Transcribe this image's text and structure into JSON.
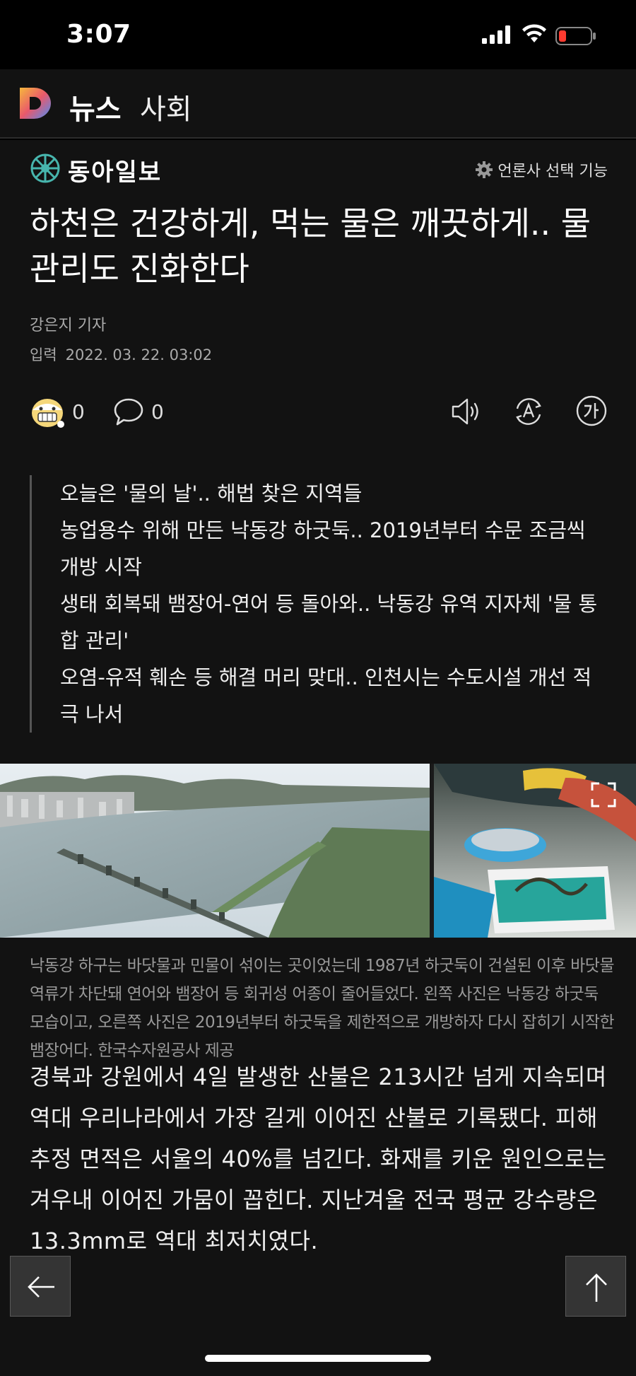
{
  "status_bar": {
    "time": "3:07"
  },
  "app": {
    "name": "뉴스",
    "section": "사회"
  },
  "press": {
    "name": "동아일보",
    "select_label": "언론사 선택 기능"
  },
  "article": {
    "headline": "하천은 건강하게, 먹는 물은 깨끗하게.. 물 관리도 진화한다",
    "reporter": "강은지 기자",
    "date_label": "입력",
    "date": "2022. 03. 22. 03:02",
    "reaction_count": "0",
    "comment_count": "0",
    "summary": [
      "오늘은 '물의 날'.. 해법 찾은 지역들",
      "농업용수 위해 만든 낙동강 하굿둑.. 2019년부터 수문 조금씩 개방 시작",
      "생태 회복돼 뱀장어-연어 등 돌아와.. 낙동강 유역 지자체 '물 통합 관리'",
      "오염-유적 훼손 등 해결 머리 맞대.. 인천시는 수도시설 개선 적극 나서"
    ],
    "caption": "낙동강 하구는 바닷물과 민물이 섞이는 곳이었는데 1987년 하굿둑이 건설된 이후 바닷물 역류가 차단돼 연어와 뱀장어 등 회귀성 어종이 줄어들었다. 왼쪽 사진은 낙동강 하굿둑 모습이고, 오른쪽 사진은 2019년부터 하굿둑을 제한적으로 개방하자 다시 잡히기 시작한 뱀장어다. 한국수자원공사 제공",
    "body": "경북과 강원에서 4일 발생한 산불은 213시간 넘게 지속되며 역대 우리나라에서 가장 길게 이어진 산불로 기록됐다. 피해 추정 면적은 서울의 40%를 넘긴다. 화재를 키운 원인으로는 겨우내 이어진 가뭄이 꼽힌다. 지난겨울 전국 평균 강수량은 13.3mm로 역대 최저치였다."
  },
  "icons": {
    "signal": "signal-icon",
    "wifi": "wifi-icon",
    "battery": "battery-icon",
    "logo": "daum-logo-icon",
    "press_logo": "donga-logo-icon",
    "gear": "gear-icon",
    "reaction": "emoji-reaction-icon",
    "comment": "comment-icon",
    "speaker": "speaker-icon",
    "translate": "translate-icon",
    "fontsize": "font-size-icon",
    "expand": "expand-icon",
    "back": "arrow-left-icon",
    "top": "arrow-up-icon"
  },
  "colors": {
    "background": "#121212",
    "battery_low": "#ff3b30",
    "press_logo": "#47b5ad"
  }
}
